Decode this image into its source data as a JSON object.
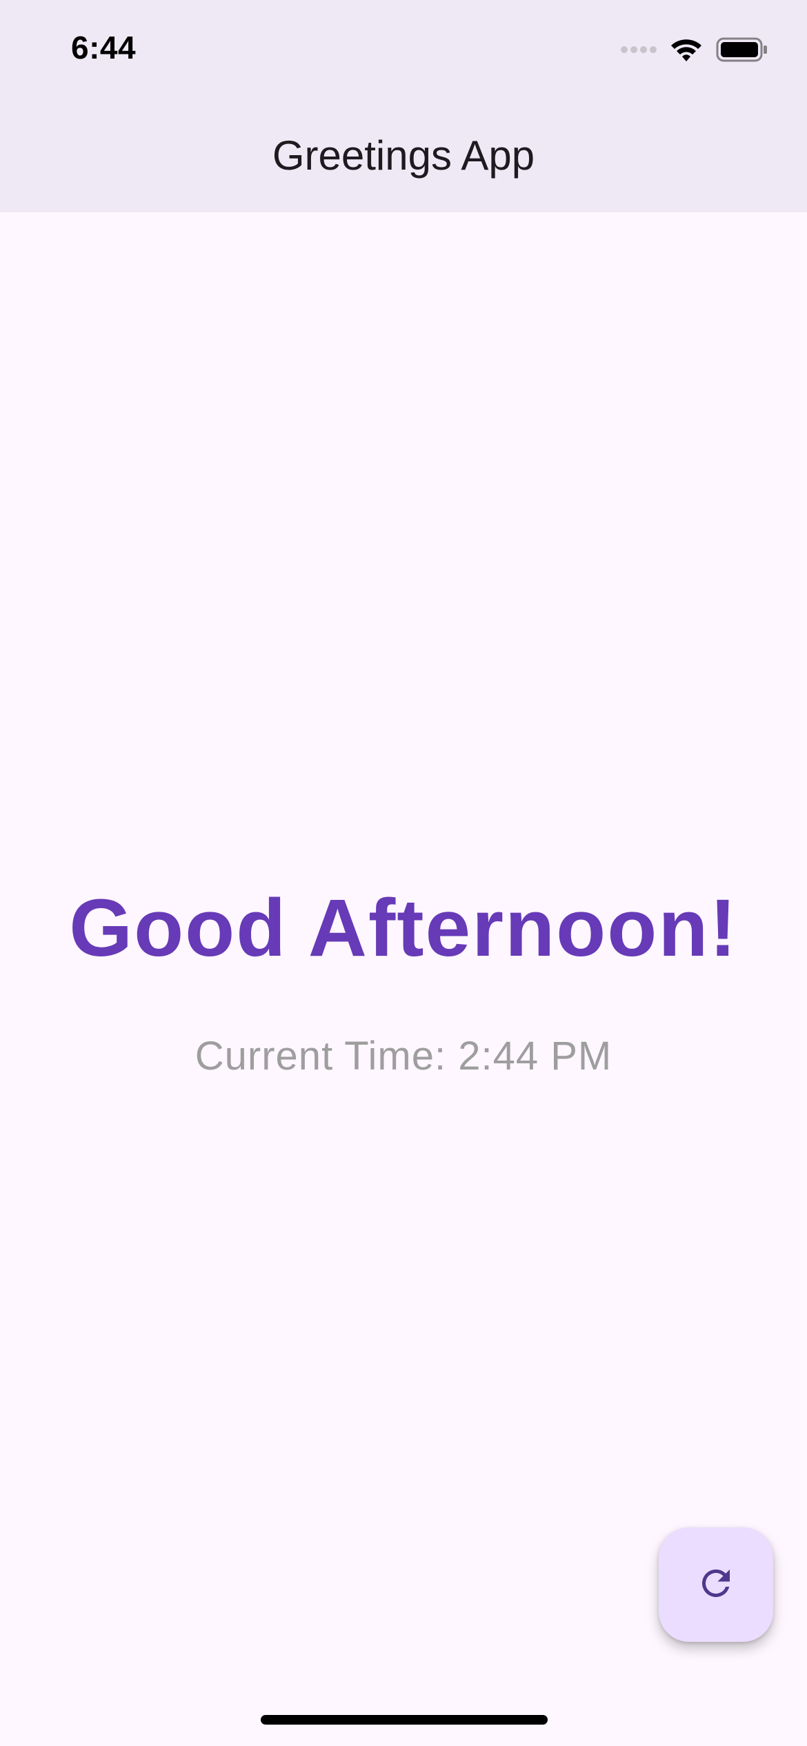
{
  "status_bar": {
    "time": "6:44",
    "icons": [
      "signal-icon",
      "wifi-icon",
      "battery-icon"
    ]
  },
  "app_bar": {
    "title": "Greetings App"
  },
  "main": {
    "greeting": "Good Afternoon!",
    "current_time": "Current Time: 2:44 PM"
  },
  "fab": {
    "icon": "refresh-icon"
  },
  "colors": {
    "background": "#FEF7FF",
    "app_bar": "#EFE9F5",
    "greeting": "#673AB7",
    "secondary_text": "#9E9E9E",
    "fab_background": "#EADDFF",
    "fab_icon": "#4F378B"
  }
}
